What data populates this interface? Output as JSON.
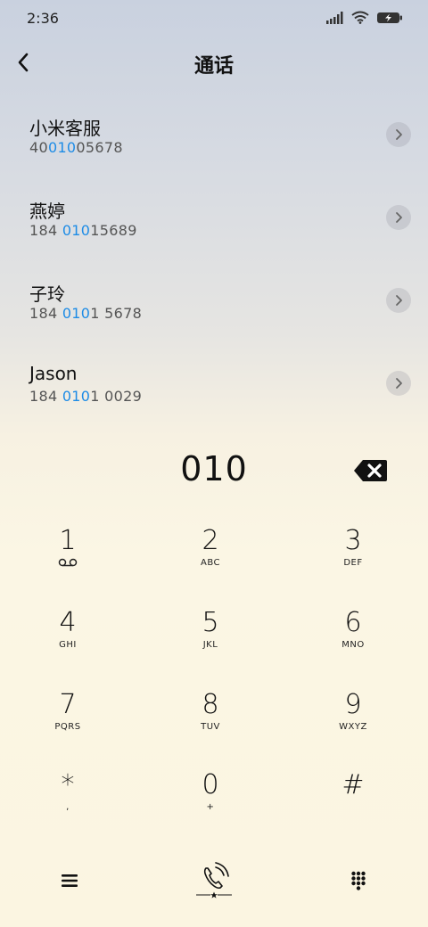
{
  "status_bar": {
    "time": "2:36",
    "icons": [
      "signal-icon",
      "wifi-icon",
      "battery-charging-icon"
    ]
  },
  "header": {
    "title": "通话",
    "back_icon": "back-arrow-icon"
  },
  "contacts": [
    {
      "name": "小米客服",
      "number_pre": "40",
      "number_match": "010",
      "number_post": "05678"
    },
    {
      "name": "燕婷",
      "number_pre": "184 ",
      "number_match": "010",
      "number_post": "15689"
    },
    {
      "name": "子玲",
      "number_pre": "184 ",
      "number_match": "010",
      "number_post": "1 5678"
    },
    {
      "name": "Jason",
      "number_pre": "184 ",
      "number_match": "010",
      "number_post": "1 0029"
    }
  ],
  "dial": {
    "number": "010",
    "delete_icon": "backspace-icon"
  },
  "keypad": [
    {
      "digit": "1",
      "letters": "",
      "sub_icon": "voicemail-icon"
    },
    {
      "digit": "2",
      "letters": "ABC"
    },
    {
      "digit": "3",
      "letters": "DEF"
    },
    {
      "digit": "4",
      "letters": "GHI"
    },
    {
      "digit": "5",
      "letters": "JKL"
    },
    {
      "digit": "6",
      "letters": "MNO"
    },
    {
      "digit": "7",
      "letters": "PQRS"
    },
    {
      "digit": "8",
      "letters": "TUV"
    },
    {
      "digit": "9",
      "letters": "WXYZ"
    },
    {
      "digit": "*",
      "letters": ","
    },
    {
      "digit": "0",
      "letters": "+"
    },
    {
      "digit": "#",
      "letters": ""
    }
  ],
  "bottom_bar": {
    "icons": [
      "menu-icon",
      "call-icon",
      "keypad-icon"
    ]
  },
  "colors": {
    "accent": "#1e8ce6",
    "text_primary": "#111111",
    "text_secondary": "#555555"
  }
}
